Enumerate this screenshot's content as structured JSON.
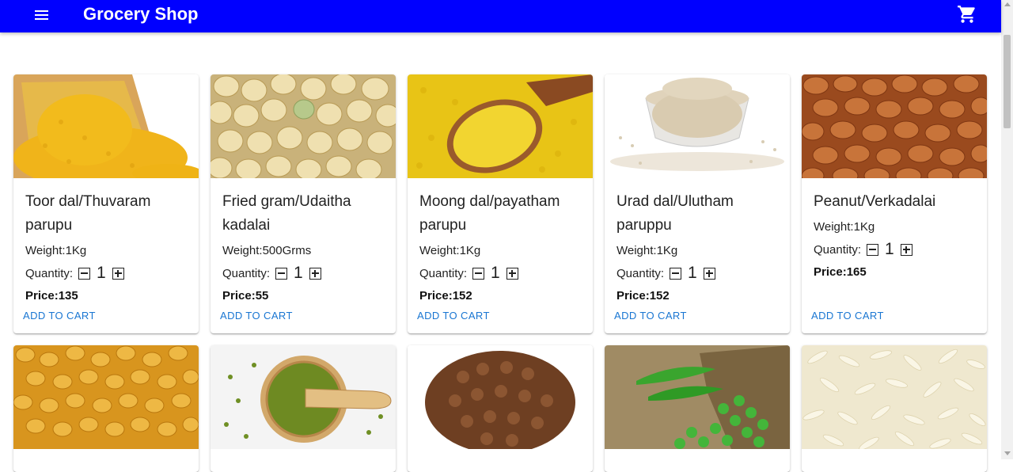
{
  "appbar": {
    "title": "Grocery Shop",
    "menu_icon": "menu-icon",
    "cart_icon": "shopping-cart-icon",
    "color": "#0000ff"
  },
  "products": [
    {
      "name": "Toor dal/Thuvaram parupu",
      "weight": "Weight:1Kg",
      "quantity_label": "Quantity:",
      "quantity": "1",
      "price": "Price:135",
      "action": "ADD TO CART"
    },
    {
      "name": "Fried gram/Udaitha kadalai",
      "weight": "Weight:500Grms",
      "quantity_label": "Quantity:",
      "quantity": "1",
      "price": "Price:55",
      "action": "ADD TO CART"
    },
    {
      "name": "Moong dal/payatham parupu",
      "weight": "Weight:1Kg",
      "quantity_label": "Quantity:",
      "quantity": "1",
      "price": "Price:152",
      "action": "ADD TO CART"
    },
    {
      "name": "Urad dal/Ulutham paruppu",
      "weight": "Weight:1Kg",
      "quantity_label": "Quantity:",
      "quantity": "1",
      "price": "Price:152",
      "action": "ADD TO CART"
    },
    {
      "name": "Peanut/Verkadalai",
      "weight": "Weight:1Kg",
      "quantity_label": "Quantity:",
      "quantity": "1",
      "price": "Price:165",
      "action": "ADD TO CART"
    }
  ],
  "accent_color": "#1976d2"
}
